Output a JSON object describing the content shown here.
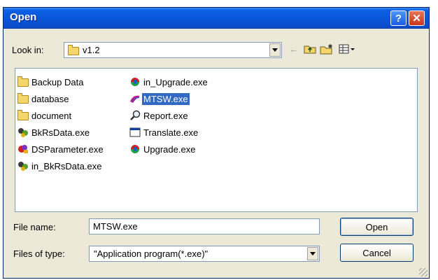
{
  "window": {
    "title": "Open"
  },
  "title_buttons": {
    "help": "?",
    "close": "✕"
  },
  "look_in": {
    "label": "Look in:",
    "value": "v1.2"
  },
  "toolbar": {
    "back": "←",
    "up_folder": "⤴",
    "new_folder": "✱",
    "view_menu": "▦▾"
  },
  "files": [
    {
      "name": "Backup Data",
      "icon": "folder-icon",
      "selected": false
    },
    {
      "name": "database",
      "icon": "folder-icon",
      "selected": false
    },
    {
      "name": "document",
      "icon": "folder-icon",
      "selected": false
    },
    {
      "name": "BkRsData.exe",
      "icon": "app-icon",
      "selected": false
    },
    {
      "name": "DSParameter.exe",
      "icon": "app-icon",
      "selected": false
    },
    {
      "name": "in_BkRsData.exe",
      "icon": "app-icon",
      "selected": false
    },
    {
      "name": "in_Upgrade.exe",
      "icon": "app-icon",
      "selected": false
    },
    {
      "name": "MTSW.exe",
      "icon": "app-icon",
      "selected": true
    },
    {
      "name": "Report.exe",
      "icon": "magnifier-icon",
      "selected": false
    },
    {
      "name": "Translate.exe",
      "icon": "window-icon",
      "selected": false
    },
    {
      "name": "Upgrade.exe",
      "icon": "app-icon",
      "selected": false
    }
  ],
  "file_name": {
    "label": "File name:",
    "value": "MTSW.exe"
  },
  "file_type": {
    "label": "Files of type:",
    "value": "\"Application program(*.exe)\""
  },
  "buttons": {
    "open": "Open",
    "cancel": "Cancel"
  },
  "colors": {
    "title_bar": "#0a55d8",
    "selection": "#316ac5",
    "dialog_bg": "#ece9d8"
  }
}
